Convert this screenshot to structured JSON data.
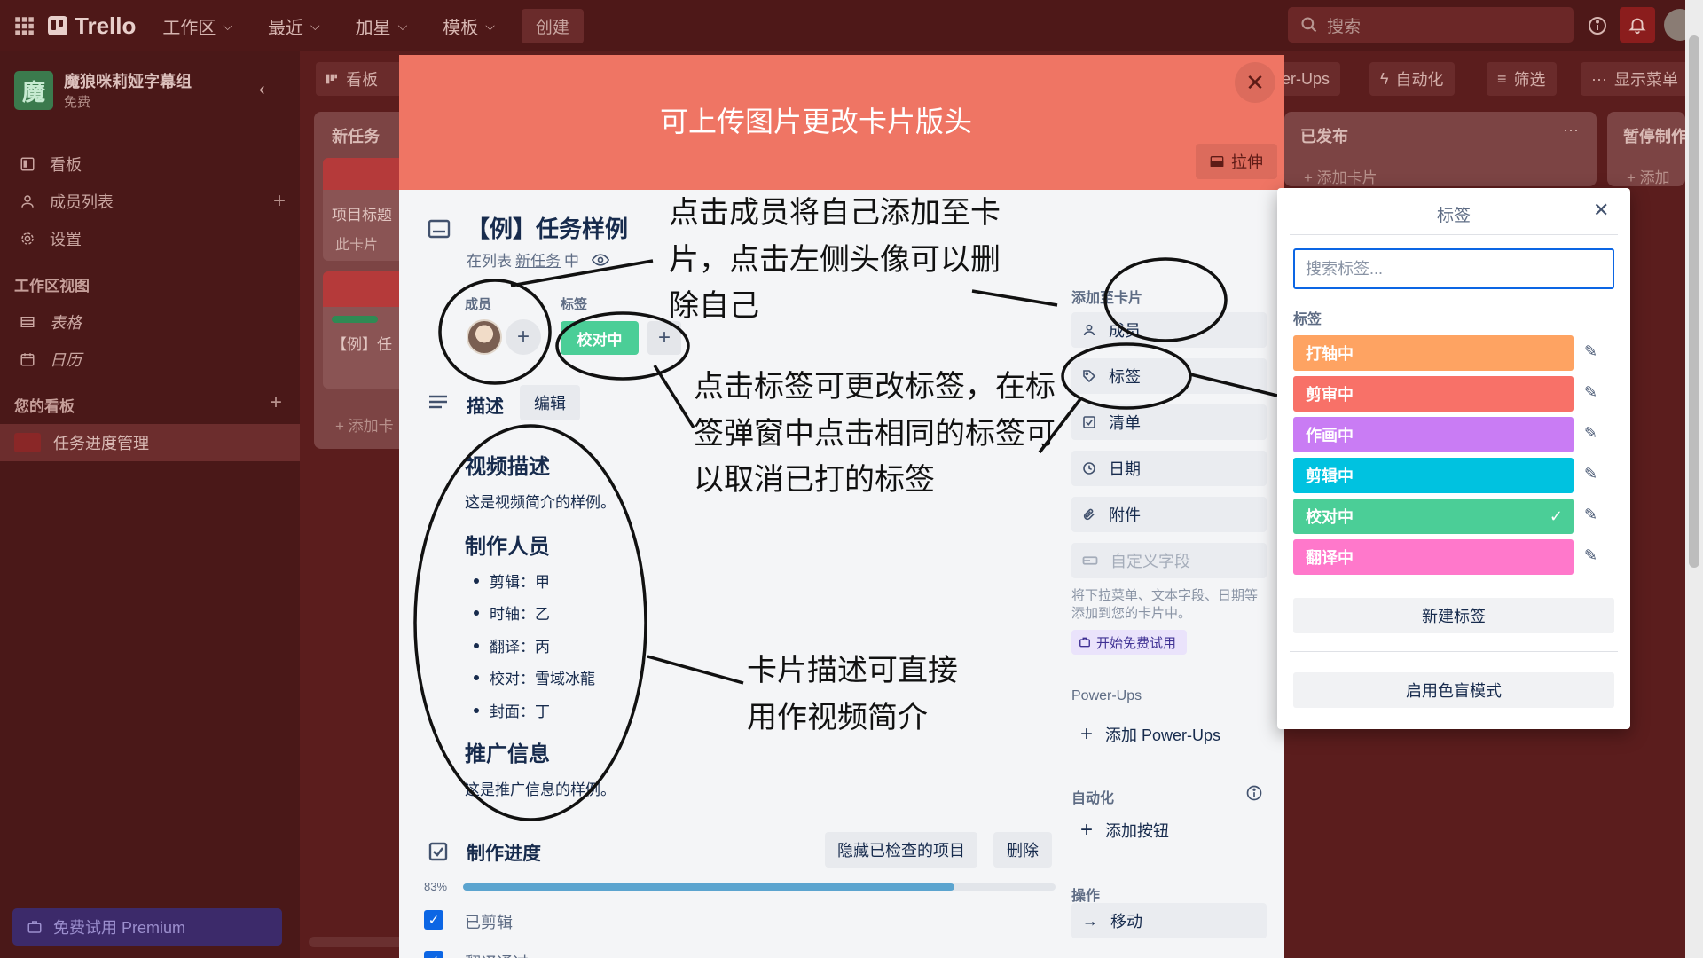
{
  "topbar": {
    "app_name": "Trello",
    "nav": [
      "工作区",
      "最近",
      "加星",
      "模板"
    ],
    "create_label": "创建",
    "search_placeholder": "搜索"
  },
  "sidebar": {
    "workspace_initial": "魔",
    "workspace_name": "魔狼咪莉娅字幕组",
    "workspace_plan": "免费",
    "items": [
      {
        "label": "看板",
        "icon": "board-icon"
      },
      {
        "label": "成员列表",
        "icon": "person-icon"
      },
      {
        "label": "设置",
        "icon": "gear-icon"
      }
    ],
    "views_heading": "工作区视图",
    "views": [
      {
        "label": "表格",
        "icon": "table-icon"
      },
      {
        "label": "日历",
        "icon": "calendar-icon"
      }
    ],
    "boards_heading": "您的看板",
    "board_name": "任务进度管理",
    "premium_label": "免费试用 Premium"
  },
  "board": {
    "view_label": "看板",
    "powerups_label": "wer-Ups",
    "automation_label": "自动化",
    "filter_label": "筛选",
    "menu_label": "显示菜单",
    "lists": [
      {
        "title": "新任务",
        "card1_title": "项目标题",
        "card1_sub": "此卡片",
        "card2_title": "【例】任",
        "add_label": "添加卡"
      },
      {
        "title": "已发布",
        "add_label": "添加卡片"
      },
      {
        "title": "暂停制作",
        "add_label": "添加"
      }
    ]
  },
  "modal": {
    "cover_title": "可上传图片更改卡片版头",
    "stretch_label": "拉伸",
    "card_title": "【例】任务样例",
    "list_prefix": "在列表",
    "list_name": "新任务",
    "list_suffix": "中",
    "members_label": "成员",
    "labels_label": "标签",
    "current_label": "校对中",
    "description_heading": "描述",
    "edit_label": "编辑",
    "description": {
      "h1": "视频描述",
      "p1": "这是视频简介的样例。",
      "h2": "制作人员",
      "staff": [
        "剪辑：甲",
        "时轴：乙",
        "翻译：丙",
        "校对：雪域冰龍",
        "封面：丁"
      ],
      "h3": "推广信息",
      "p3": "这是推广信息的样例。"
    },
    "checklist": {
      "title": "制作进度",
      "hide_checked_label": "隐藏已检查的项目",
      "delete_label": "删除",
      "percent_text": "83%",
      "percent": 83,
      "items": [
        "已剪辑",
        "翻译通过"
      ]
    },
    "add_to_card": {
      "heading": "添加至卡片",
      "buttons": [
        {
          "label": "成员",
          "icon": "person-icon"
        },
        {
          "label": "标签",
          "icon": "tag-icon"
        },
        {
          "label": "清单",
          "icon": "checklist-icon"
        },
        {
          "label": "日期",
          "icon": "clock-icon"
        },
        {
          "label": "附件",
          "icon": "paperclip-icon"
        },
        {
          "label": "自定义字段",
          "icon": "field-icon"
        }
      ],
      "hint": "将下拉菜单、文本字段、日期等添加到您的卡片中。",
      "trial_label": "开始免费试用"
    },
    "powerups": {
      "heading": "Power-Ups",
      "add_label": "添加 Power-Ups"
    },
    "automation": {
      "heading": "自动化",
      "add_label": "添加按钮"
    },
    "actions": {
      "heading": "操作",
      "move_label": "移动"
    }
  },
  "annotations": {
    "members_tip": "点击成员将自己添加至卡片，点击左侧头像可以删除自己",
    "members_tip_lines": [
      "点击成员将自己添加至卡",
      "片，点击左侧头像可以删",
      "除自己"
    ],
    "label_tip_lines": [
      "点击标签可更改标签，在标",
      "签弹窗中点击相同的标签可",
      "以取消已打的标签"
    ],
    "desc_tip_lines": [
      "卡片描述可直接",
      "用作视频简介"
    ]
  },
  "label_popover": {
    "title": "标签",
    "search_placeholder": "搜索标签...",
    "section": "标签",
    "labels": [
      {
        "name": "打轴中",
        "color": "#fea362",
        "checked": false
      },
      {
        "name": "剪审中",
        "color": "#f87168",
        "checked": false
      },
      {
        "name": "作画中",
        "color": "#c97cf4",
        "checked": false
      },
      {
        "name": "剪辑中",
        "color": "#00c2e0",
        "checked": false
      },
      {
        "name": "校对中",
        "color": "#4bce97",
        "checked": true
      },
      {
        "name": "翻译中",
        "color": "#ff78cb",
        "checked": false
      }
    ],
    "new_label": "新建标签",
    "colorblind_label": "启用色盲模式"
  },
  "colors": {
    "board_bg": "#5b1d1d",
    "cover": "#ef7564",
    "accent": "#0c66e4",
    "progress": "#5ba4cf"
  }
}
